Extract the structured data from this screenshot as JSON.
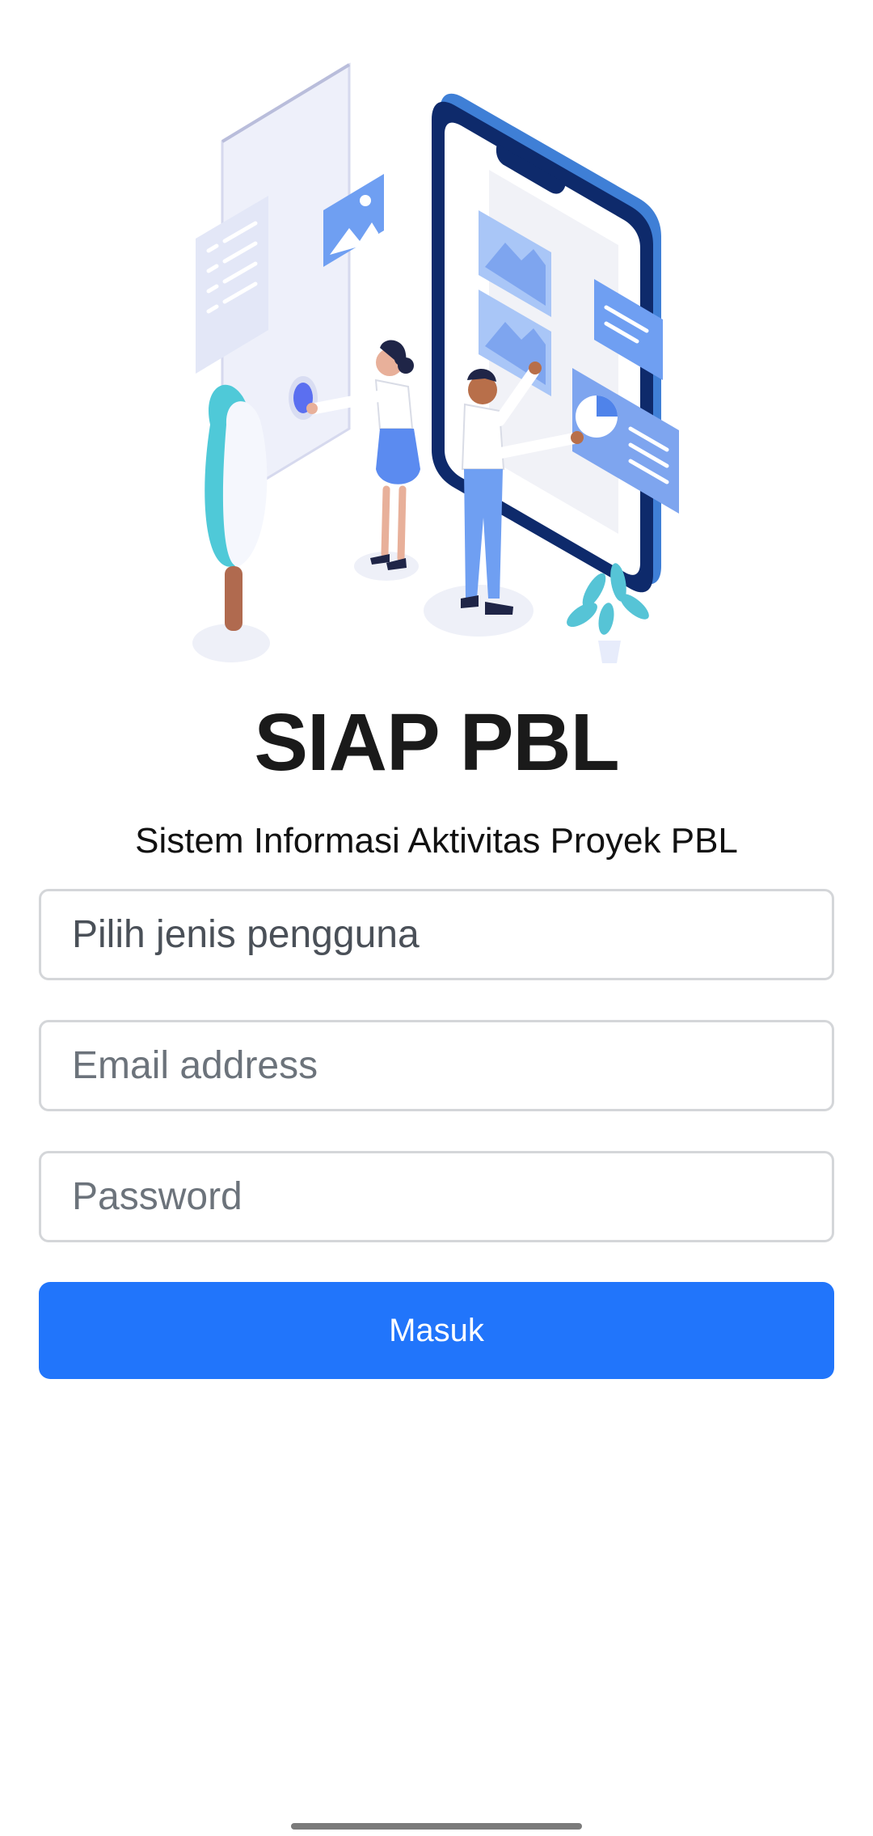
{
  "app": {
    "title": "SIAP PBL",
    "subtitle": "Sistem Informasi Aktivitas Proyek PBL"
  },
  "form": {
    "user_type_select": {
      "placeholder": "Pilih jenis pengguna"
    },
    "email": {
      "value": "",
      "placeholder": "Email address"
    },
    "password": {
      "value": "",
      "placeholder": "Password"
    },
    "submit_label": "Masuk"
  },
  "colors": {
    "primary": "#2175fb",
    "title": "#1a1a1a",
    "border": "#d4d6d9",
    "placeholder": "#6c737b"
  },
  "icons": {
    "hero": "mobile-app-team-illustration"
  }
}
